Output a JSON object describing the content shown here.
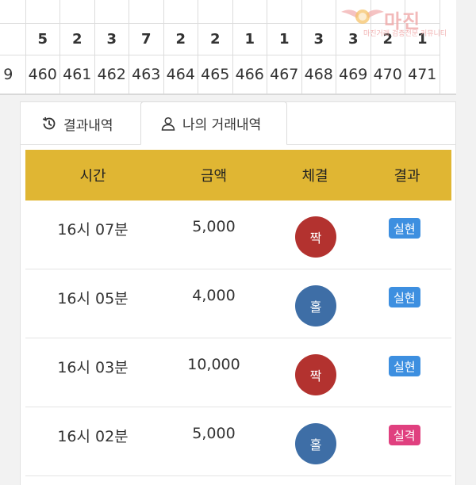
{
  "history": {
    "columns": [
      {
        "count": "",
        "round": "9"
      },
      {
        "count": "5",
        "round": "460"
      },
      {
        "count": "2",
        "round": "461"
      },
      {
        "count": "3",
        "round": "462"
      },
      {
        "count": "7",
        "round": "463"
      },
      {
        "count": "2",
        "round": "464"
      },
      {
        "count": "2",
        "round": "465"
      },
      {
        "count": "1",
        "round": "466"
      },
      {
        "count": "1",
        "round": "467"
      },
      {
        "count": "3",
        "round": "468"
      },
      {
        "count": "3",
        "round": "469"
      },
      {
        "count": "2",
        "round": "470"
      },
      {
        "count": "1",
        "round": "471"
      }
    ]
  },
  "watermark": {
    "title": "마진",
    "subtitle": "마진거래 검증전문 커뮤니티"
  },
  "tabs": {
    "result_label": "결과내역",
    "my_label": "나의 거래내역"
  },
  "table": {
    "headers": {
      "time": "시간",
      "amount": "금액",
      "fill": "체결",
      "result": "결과"
    },
    "rows": [
      {
        "time": "16시 07분",
        "amount": "5,000",
        "fill": "짝",
        "result": "실현"
      },
      {
        "time": "16시 05분",
        "amount": "4,000",
        "fill": "홀",
        "result": "실현"
      },
      {
        "time": "16시 03분",
        "amount": "10,000",
        "fill": "짝",
        "result": "실현"
      },
      {
        "time": "16시 02분",
        "amount": "5,000",
        "fill": "홀",
        "result": "실격"
      }
    ]
  },
  "colors": {
    "header_bg": "#e0b633",
    "even_red": "#b3322f",
    "odd_blue": "#3e6ea6",
    "win_badge": "#3d8fe0",
    "lose_badge": "#e0407f"
  }
}
